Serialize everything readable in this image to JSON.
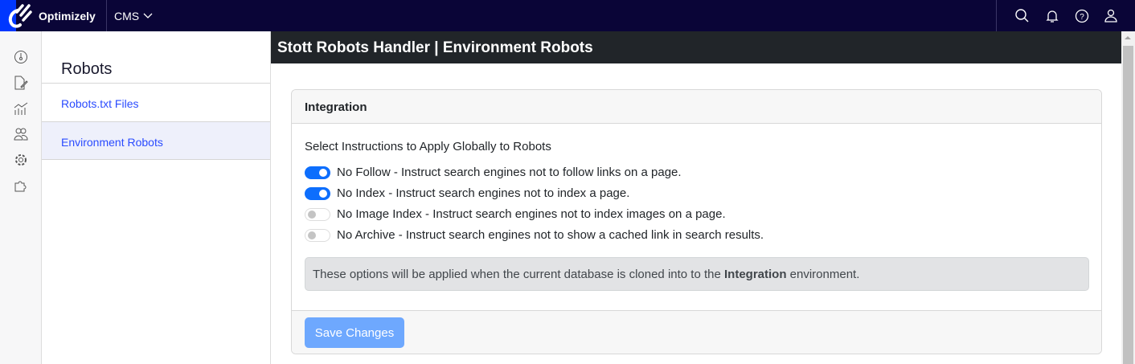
{
  "topbar": {
    "brand": "Optimizely",
    "product": "CMS"
  },
  "nav": {
    "title": "Robots",
    "items": [
      {
        "label": "Robots.txt Files"
      },
      {
        "label": "Environment Robots"
      }
    ]
  },
  "header": {
    "title": "Stott Robots Handler | Environment Robots"
  },
  "card": {
    "title": "Integration",
    "lead": "Select Instructions to Apply Globally to Robots",
    "options": [
      {
        "label": "No Follow - Instruct search engines not to follow links on a page.",
        "checked": true
      },
      {
        "label": "No Index - Instruct search engines not to index a page.",
        "checked": true
      },
      {
        "label": "No Image Index - Instruct search engines not to index images on a page.",
        "checked": false
      },
      {
        "label": "No Archive - Instruct search engines not to show a cached link in search results.",
        "checked": false
      }
    ],
    "alert": {
      "before": "These options will be applied when the current database is cloned into to the ",
      "env": "Integration",
      "after": " environment."
    },
    "save_label": "Save Changes"
  }
}
